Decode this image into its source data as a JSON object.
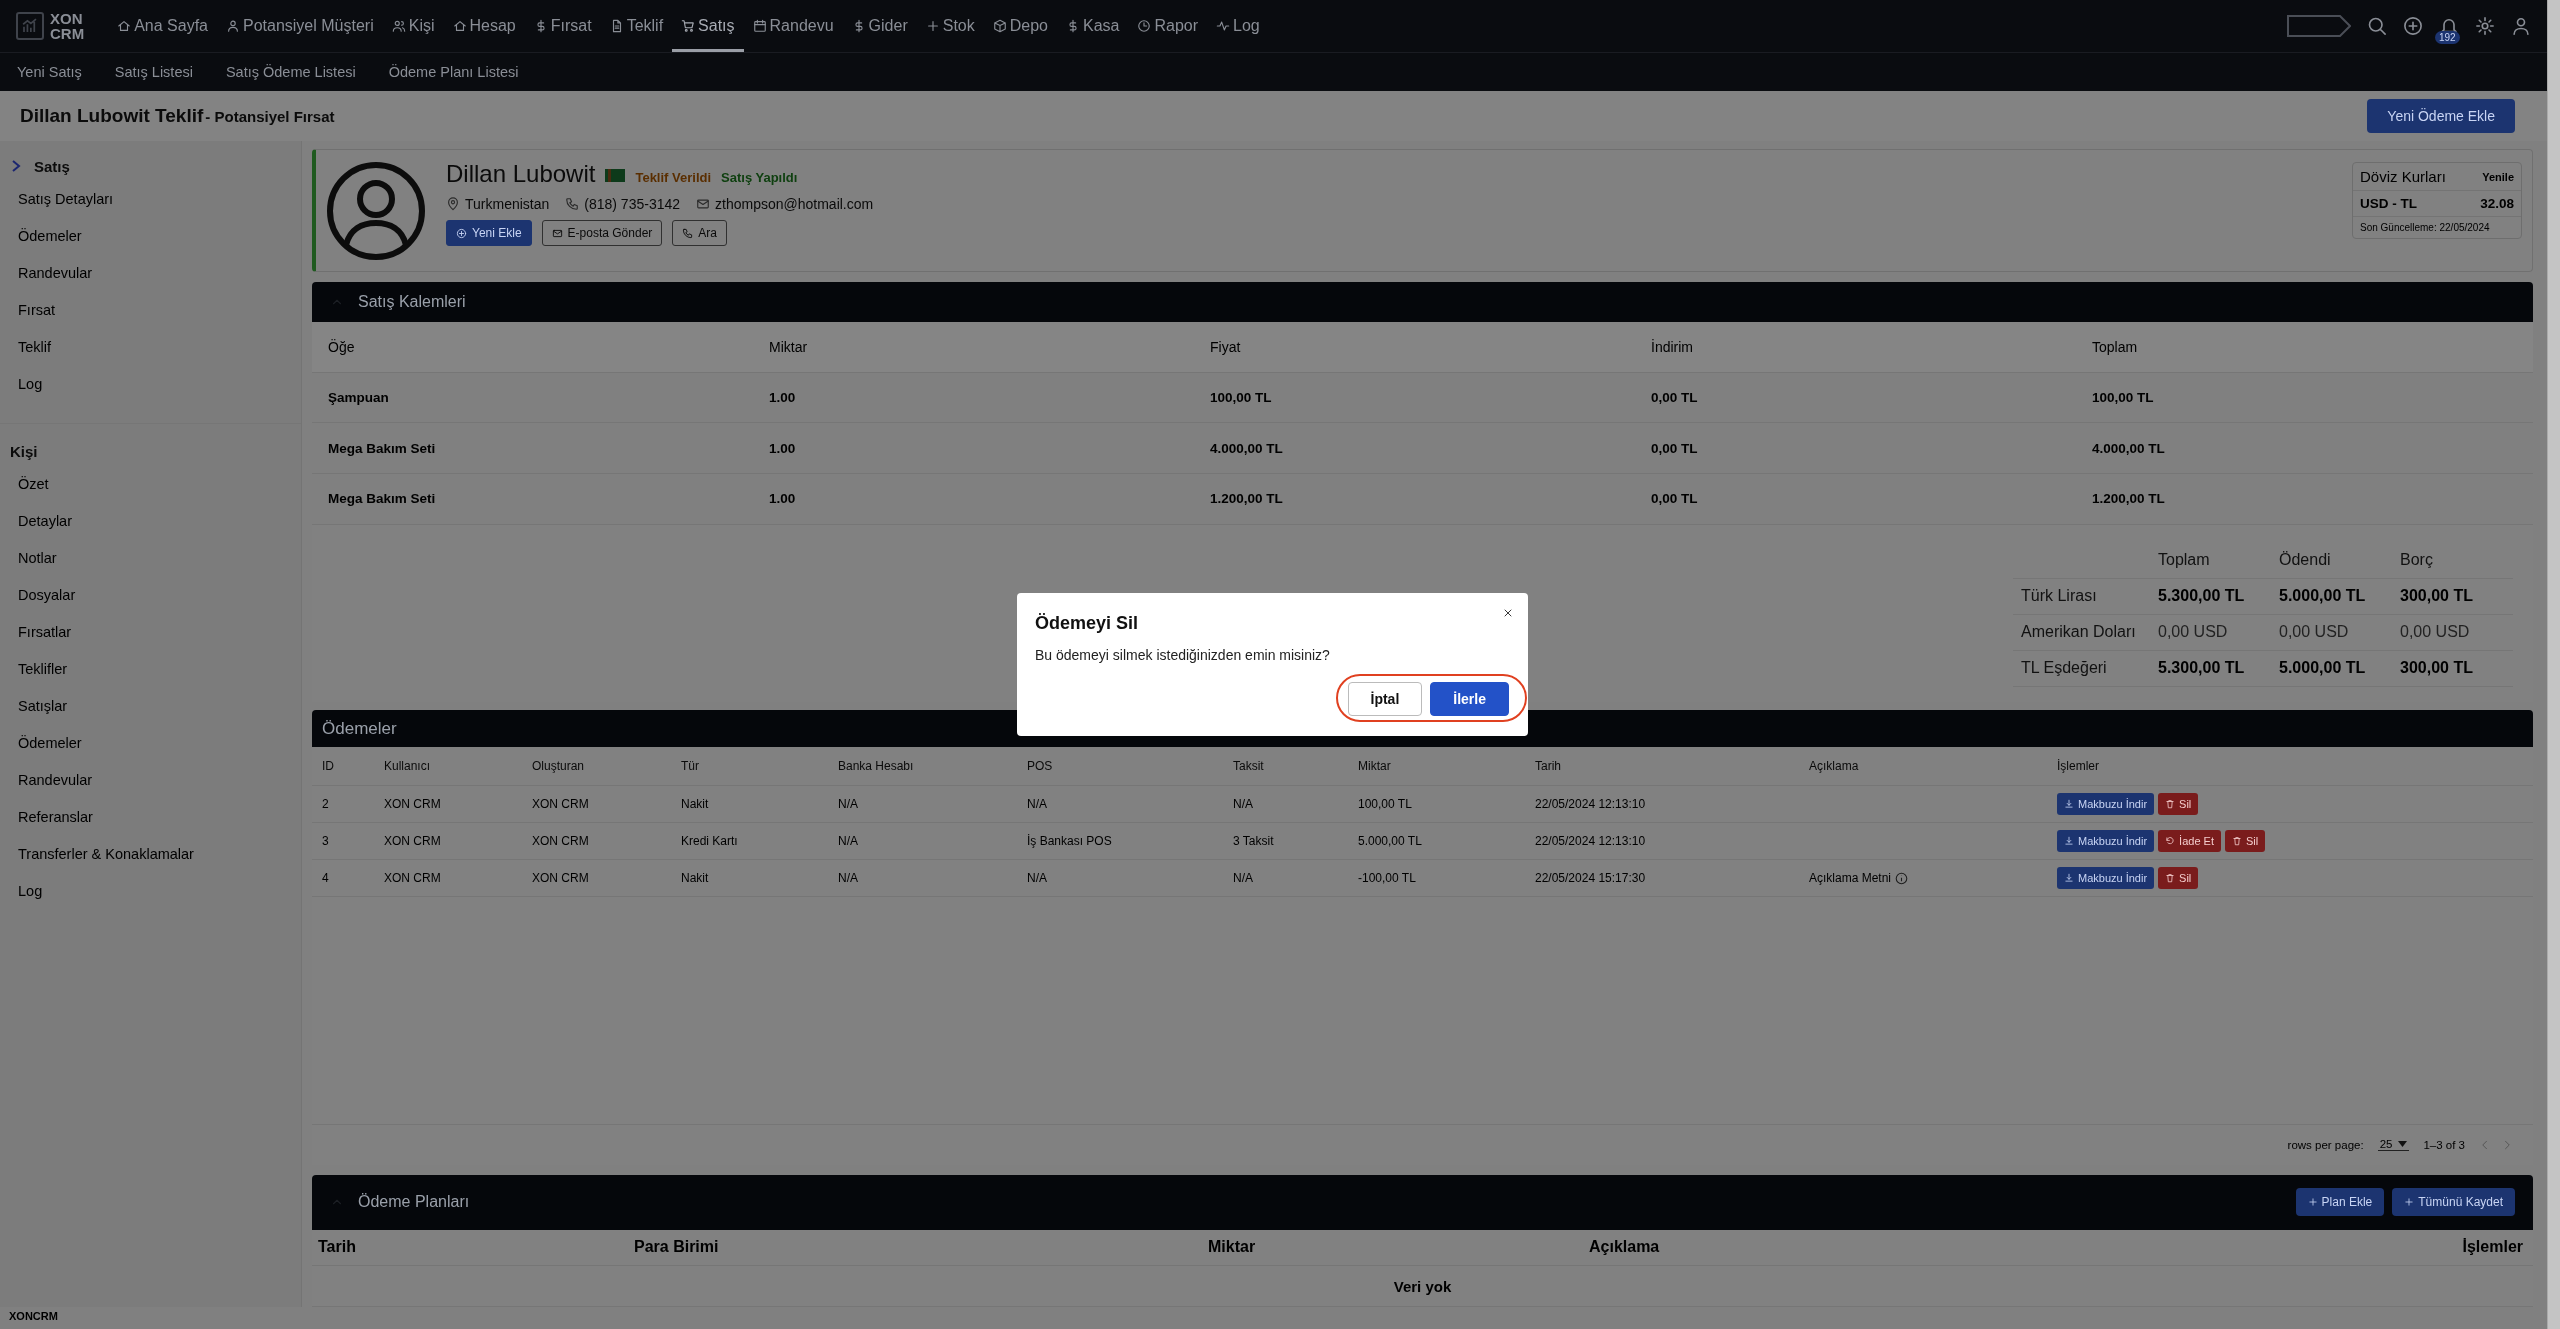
{
  "nav": {
    "logo": [
      "XON",
      "CRM"
    ],
    "items": [
      {
        "label": "Ana Sayfa",
        "selected": false
      },
      {
        "label": "Potansiyel Müşteri",
        "selected": false
      },
      {
        "label": "Kişi",
        "selected": false
      },
      {
        "label": "Hesap",
        "selected": false
      },
      {
        "label": "Fırsat",
        "selected": false
      },
      {
        "label": "Teklif",
        "selected": false
      },
      {
        "label": "Satış",
        "selected": true
      },
      {
        "label": "Randevu",
        "selected": false
      },
      {
        "label": "Gider",
        "selected": false
      },
      {
        "label": "Stok",
        "selected": false
      },
      {
        "label": "Depo",
        "selected": false
      },
      {
        "label": "Kasa",
        "selected": false
      },
      {
        "label": "Rapor",
        "selected": false
      },
      {
        "label": "Log",
        "selected": false
      }
    ],
    "notification_count": "192"
  },
  "subnav": [
    "Yeni Satış",
    "Satış Listesi",
    "Satış Ödeme Listesi",
    "Ödeme Planı Listesi"
  ],
  "header": {
    "title": "Dillan Lubowit Teklif",
    "subtitle": "- Potansiyel Fırsat",
    "button": "Yeni Ödeme Ekle"
  },
  "sidebar": {
    "sections": [
      {
        "title": "Satış",
        "expanded": true,
        "items": [
          "Satış Detayları",
          "Ödemeler",
          "Randevular",
          "Fırsat",
          "Teklif",
          "Log"
        ]
      },
      {
        "title": "Kişi",
        "expanded": false,
        "items": [
          "Özet",
          "Detaylar",
          "Notlar",
          "Dosyalar",
          "Fırsatlar",
          "Teklifler",
          "Satışlar",
          "Ödemeler",
          "Randevular",
          "Referanslar",
          "Transferler & Konaklamalar",
          "Log"
        ]
      }
    ]
  },
  "profile": {
    "name": "Dillan Lubowit",
    "tags": [
      {
        "label": "Teklif Verildi",
        "color": "#5a2e00"
      },
      {
        "label": "Satış Yapıldı",
        "color": "#0f4010"
      }
    ],
    "location": "Turkmenistan",
    "phone": "(818) 735-3142",
    "email": "zthompson@hotmail.com",
    "buttons": [
      {
        "label": "Yeni Ekle",
        "kind": "primary"
      },
      {
        "label": "E-posta Gönder",
        "kind": "outline"
      },
      {
        "label": "Ara",
        "kind": "outline"
      }
    ]
  },
  "exchange": {
    "title": "Döviz Kurları",
    "refresh": "Yenile",
    "pair": "USD - TL",
    "rate": "32.08",
    "updated": "Son Güncelleme: 22/05/2024"
  },
  "sales_items": {
    "title": "Satış Kalemleri",
    "columns": [
      "Öğe",
      "Miktar",
      "Fiyat",
      "İndirim",
      "Toplam"
    ],
    "rows": [
      [
        "Şampuan",
        "1.00",
        "100,00 TL",
        "0,00 TL",
        "100,00 TL"
      ],
      [
        "Mega Bakım Seti",
        "1.00",
        "4.000,00 TL",
        "0,00 TL",
        "4.000,00 TL"
      ],
      [
        "Mega Bakım Seti",
        "1.00",
        "1.200,00 TL",
        "0,00 TL",
        "1.200,00 TL"
      ]
    ]
  },
  "totals": {
    "columns": [
      "Toplam",
      "Ödendi",
      "Borç"
    ],
    "rows": [
      {
        "label": "Türk Lirası",
        "muted": false,
        "values": [
          "5.300,00 TL",
          "5.000,00 TL",
          "300,00 TL"
        ]
      },
      {
        "label": "Amerikan Doları",
        "muted": true,
        "values": [
          "0,00 USD",
          "0,00 USD",
          "0,00 USD"
        ]
      },
      {
        "label": "TL Eşdeğeri",
        "muted": false,
        "values": [
          "5.300,00 TL",
          "5.000,00 TL",
          "300,00 TL"
        ]
      }
    ]
  },
  "payments": {
    "title": "Ödemeler",
    "columns": [
      "ID",
      "Kullanıcı",
      "Oluşturan",
      "Tür",
      "Banka Hesabı",
      "POS",
      "Taksit",
      "Miktar",
      "Tarih",
      "Açıklama",
      "İşlemler"
    ],
    "rows": [
      {
        "cells": [
          "2",
          "XON CRM",
          "XON CRM",
          "Nakit",
          "N/A",
          "N/A",
          "N/A",
          "100,00 TL",
          "22/05/2024 12:13:10",
          ""
        ],
        "info_icon": false,
        "actions": [
          {
            "label": "Makbuzu İndir",
            "kind": "download"
          },
          {
            "label": "Sil",
            "kind": "delete"
          }
        ]
      },
      {
        "cells": [
          "3",
          "XON CRM",
          "XON CRM",
          "Kredi Kartı",
          "N/A",
          "İş Bankası POS",
          "3 Taksit",
          "5.000,00 TL",
          "22/05/2024 12:13:10",
          ""
        ],
        "info_icon": false,
        "actions": [
          {
            "label": "Makbuzu İndir",
            "kind": "download"
          },
          {
            "label": "İade Et",
            "kind": "refund"
          },
          {
            "label": "Sil",
            "kind": "delete"
          }
        ]
      },
      {
        "cells": [
          "4",
          "XON CRM",
          "XON CRM",
          "Nakit",
          "N/A",
          "N/A",
          "N/A",
          "-100,00 TL",
          "22/05/2024 15:17:30",
          "Açıklama Metni"
        ],
        "info_icon": true,
        "actions": [
          {
            "label": "Makbuzu İndir",
            "kind": "download"
          },
          {
            "label": "Sil",
            "kind": "delete"
          }
        ]
      }
    ],
    "pagination": {
      "rows_per_page_label": "rows per page:",
      "rows_per_page": "25",
      "range": "1–3 of 3"
    }
  },
  "plans": {
    "title": "Ödeme Planları",
    "buttons": [
      "Plan Ekle",
      "Tümünü Kaydet"
    ],
    "columns": [
      "Tarih",
      "Para Birimi",
      "Miktar",
      "Açıklama",
      "İşlemler"
    ],
    "empty": "Veri yok"
  },
  "footer": "XONCRM",
  "dialog": {
    "title": "Ödemeyi Sil",
    "message": "Bu ödemeyi silmek istediğinizden emin misiniz?",
    "buttons": [
      {
        "label": "İptal",
        "kind": "secondary"
      },
      {
        "label": "İlerle",
        "kind": "primary"
      }
    ]
  }
}
